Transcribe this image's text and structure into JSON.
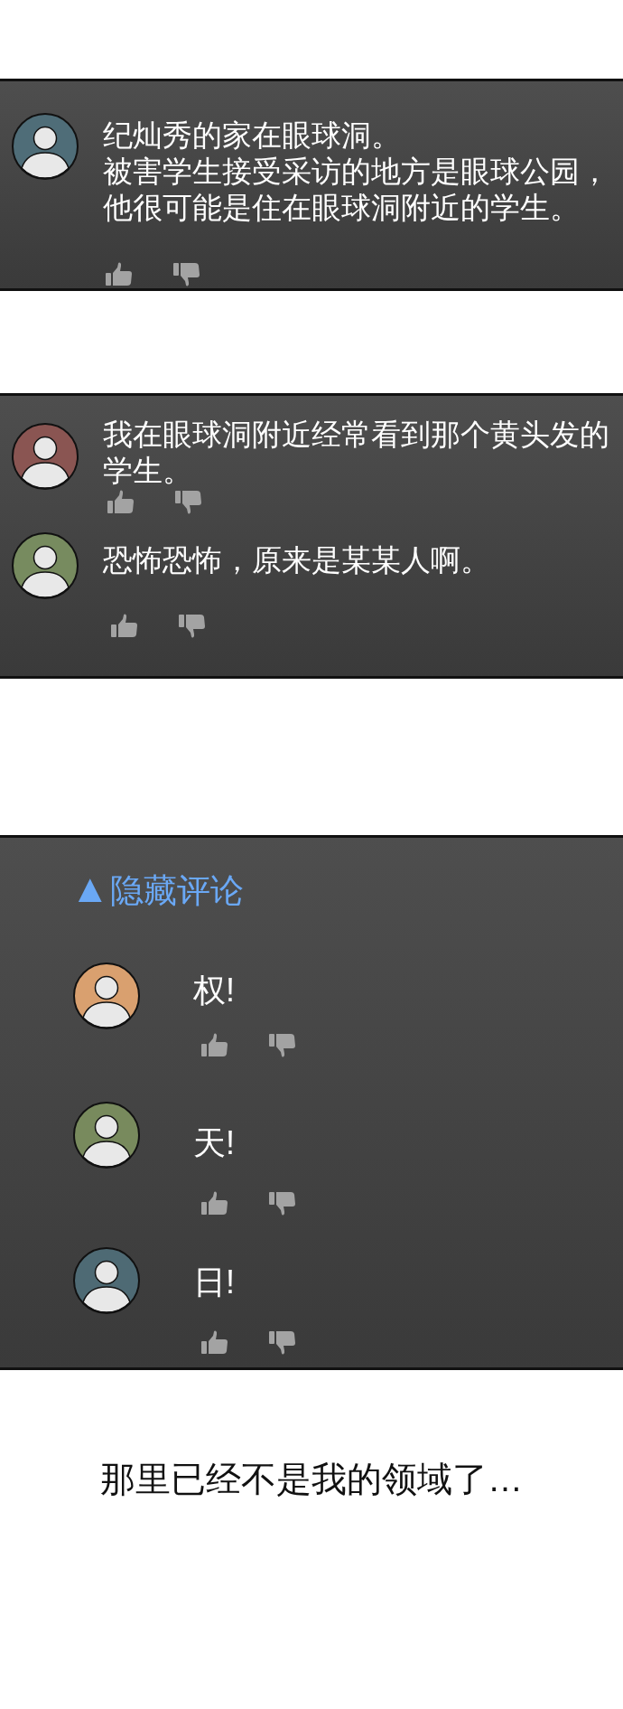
{
  "panels": [
    {
      "comments": [
        {
          "color": "#4f6d78",
          "paragraphs": [
            "纪灿秀的家在眼球洞。",
            "被害学生接受采访的地方是眼球公园，他很可能是住在眼球洞附近的学生。"
          ]
        }
      ]
    },
    {
      "comments": [
        {
          "color": "#8a5552",
          "paragraphs": [
            "我在眼球洞附近经常看到那个黄头发的学生。"
          ]
        },
        {
          "color": "#778b5f",
          "paragraphs": [
            "恐怖恐怖，原来是某某人啊。"
          ]
        }
      ]
    },
    {
      "toggle": {
        "arrow": "▲",
        "label": "隐藏评论"
      },
      "comments": [
        {
          "color": "#d9a06f",
          "paragraphs": [
            "权!"
          ]
        },
        {
          "color": "#788a5d",
          "paragraphs": [
            "天!"
          ]
        },
        {
          "color": "#4e6a74",
          "paragraphs": [
            "日!"
          ]
        }
      ]
    }
  ],
  "caption": "那里已经不是我的领域了…"
}
